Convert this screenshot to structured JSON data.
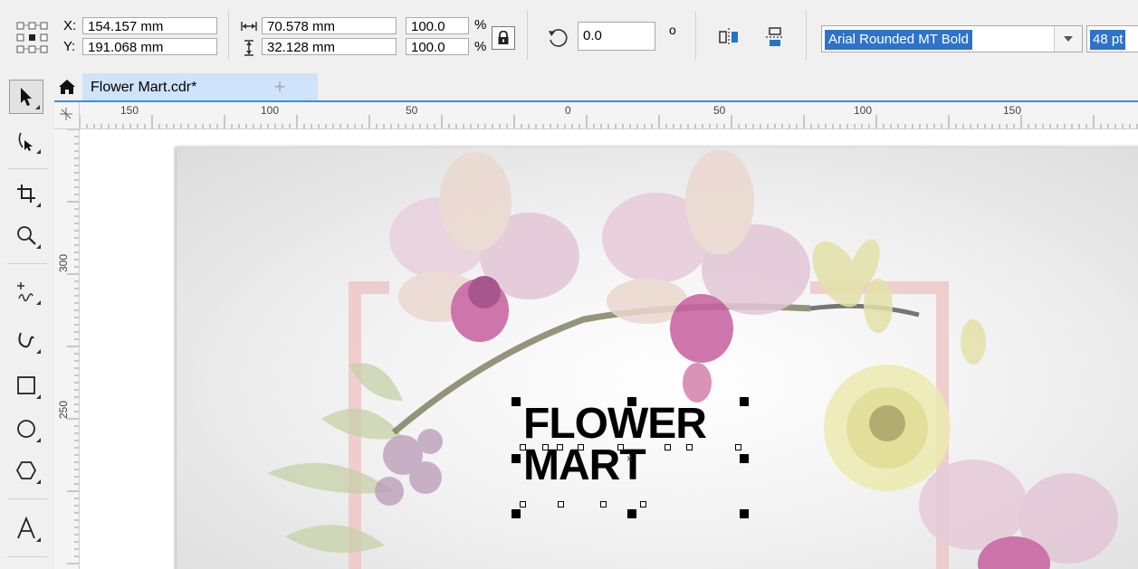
{
  "propbar": {
    "x_label": "X:",
    "x_value": "154.157 mm",
    "y_label": "Y:",
    "y_value": "191.068 mm",
    "width_value": "70.578 mm",
    "height_value": "32.128 mm",
    "scale_x": "100.0",
    "scale_y": "100.0",
    "percent": "%",
    "rotation": "0.0",
    "degree": "o",
    "font_name": "Arial Rounded MT Bold",
    "font_size": "48 pt"
  },
  "tabs": {
    "document": "Flower Mart.cdr*",
    "new_tab": "+"
  },
  "ruler": {
    "h_labels": [
      "150",
      "100",
      "50",
      "0",
      "50",
      "100",
      "150"
    ],
    "v_labels": [
      "300",
      "250"
    ]
  },
  "canvas": {
    "text": "FLOWER\nMART"
  },
  "icons": {
    "object_origin": "reference-grid-icon",
    "lock_ratio": "lock-icon",
    "rotate": "rotate-icon",
    "mirror_h": "mirror-horizontal-icon",
    "mirror_v": "mirror-vertical-icon",
    "home": "home-icon"
  },
  "colors": {
    "accent": "#3b8ede",
    "selection": "#2e73c9",
    "tab_active": "#cfe3fa"
  }
}
